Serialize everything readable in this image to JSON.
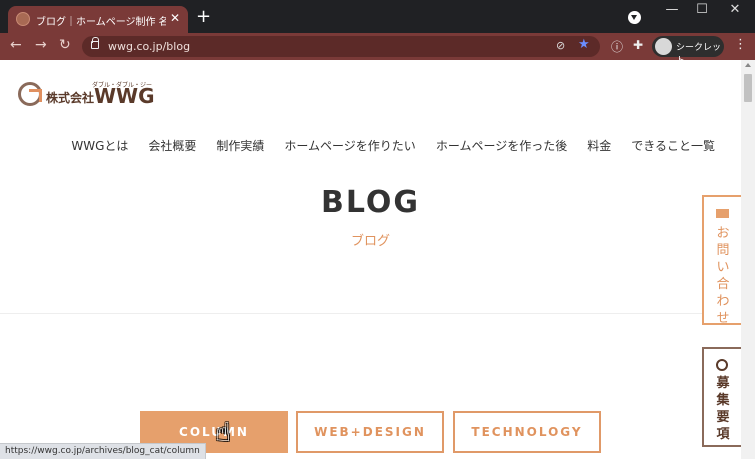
{
  "browser": {
    "tab": {
      "title": "ブログ｜ホームページ制作 名古屋 愛",
      "close": "✕"
    },
    "new_tab": "+",
    "window": {
      "minimize": "—",
      "maximize": "☐",
      "close": "✕"
    },
    "nav": {
      "back": "←",
      "forward": "→",
      "reload": "↻"
    },
    "url": "wwg.co.jp/blog",
    "incognito_label": "シークレット",
    "status_url": "https://wwg.co.jp/archives/blog_cat/column"
  },
  "site": {
    "logo": {
      "prefix": "株式会社",
      "name": "WWG",
      "ruby": "ダブル・ダブル・ジー"
    },
    "nav": [
      {
        "label": "WWGとは"
      },
      {
        "label": "会社概要"
      },
      {
        "label": "制作実績"
      },
      {
        "label": "ホームページを作りたい"
      },
      {
        "label": "ホームページを作った後"
      },
      {
        "label": "料金"
      },
      {
        "label": "できること一覧"
      }
    ],
    "hero": {
      "title": "BLOG",
      "subtitle": "ブログ"
    },
    "categories": [
      {
        "label": "COLUMN",
        "active": true
      },
      {
        "label": "WEB+DESIGN",
        "active": false
      },
      {
        "label": "TECHNOLOGY",
        "active": false
      }
    ],
    "side": {
      "contact": "お問い合わせ",
      "recruit": "募集要項"
    }
  },
  "colors": {
    "accent": "#e6a06c",
    "brand_brown": "#5a3a2a",
    "tab_bg": "#7a3a38"
  }
}
